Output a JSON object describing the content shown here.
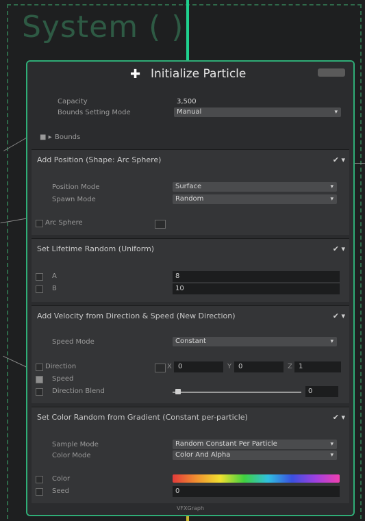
{
  "system": {
    "title": "System ( )"
  },
  "node": {
    "title": "Initialize Particle",
    "badge": "",
    "capacity_label": "Capacity",
    "capacity_value": "3,500",
    "bounds_mode_label": "Bounds Setting Mode",
    "bounds_mode_value": "Manual",
    "bounds_label": "Bounds",
    "footer": "VFXGraph"
  },
  "blocks": [
    {
      "title": "Add Position (Shape: Arc Sphere)",
      "fields": [
        {
          "label": "Position Mode",
          "value": "Surface"
        },
        {
          "label": "Spawn Mode",
          "value": "Random"
        },
        {
          "label": "Arc Sphere",
          "value": ""
        }
      ]
    },
    {
      "title": "Set Lifetime Random (Uniform)",
      "fields": [
        {
          "label": "A",
          "value": "8"
        },
        {
          "label": "B",
          "value": "10"
        }
      ]
    },
    {
      "title": "Add Velocity from Direction & Speed (New Direction)",
      "fields": [
        {
          "label": "Speed Mode",
          "value": "Constant"
        },
        {
          "label": "Direction",
          "x": "0",
          "y": "0",
          "z": "1"
        },
        {
          "label": "Speed",
          "value": ""
        },
        {
          "label": "Direction Blend",
          "value": "0"
        }
      ]
    },
    {
      "title": "Set Color Random from Gradient (Constant per-particle)",
      "fields": [
        {
          "label": "Sample Mode",
          "value": "Random Constant Per Particle"
        },
        {
          "label": "Color Mode",
          "value": "Color And Alpha"
        },
        {
          "label": "Color",
          "value": ""
        },
        {
          "label": "Seed",
          "value": "0"
        }
      ]
    }
  ],
  "icons": {
    "node": "particle-icon",
    "caret": "chevron-down-icon",
    "ctrl": "check-icon"
  },
  "colors": {
    "flow_in": "#1fd08e",
    "flow_out": "#c9b630",
    "node_border": "#2fae77"
  },
  "direction_blend_level": 0.02
}
